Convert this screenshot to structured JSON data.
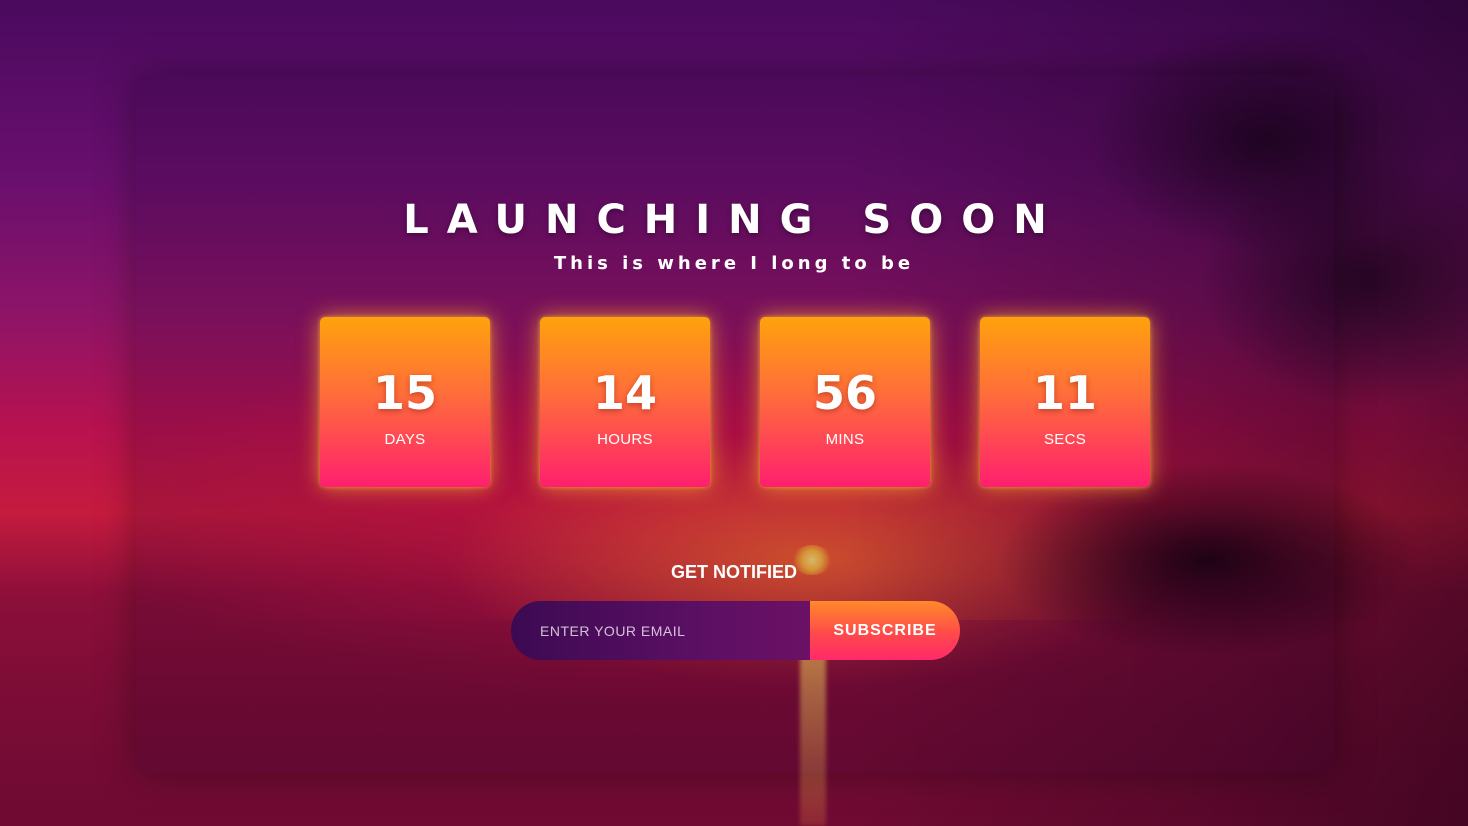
{
  "page": {
    "title": "LAUNCHING SOON",
    "subtitle": "This is where I long to be"
  },
  "countdown": [
    {
      "value": "15",
      "unit": "DAYS"
    },
    {
      "value": "14",
      "unit": "HOURS"
    },
    {
      "value": "56",
      "unit": "MINS"
    },
    {
      "value": "11",
      "unit": "SECS"
    }
  ],
  "notify": {
    "heading": "GET NOTIFIED",
    "email_placeholder": "ENTER YOUR EMAIL",
    "email_value": "",
    "subscribe_label": "SUBSCRIBE"
  },
  "colors": {
    "tile_top": "#ffa20c",
    "tile_bottom": "#ff1f6e",
    "background_top": "#4a0a5e",
    "background_mid": "#c51b3e"
  }
}
